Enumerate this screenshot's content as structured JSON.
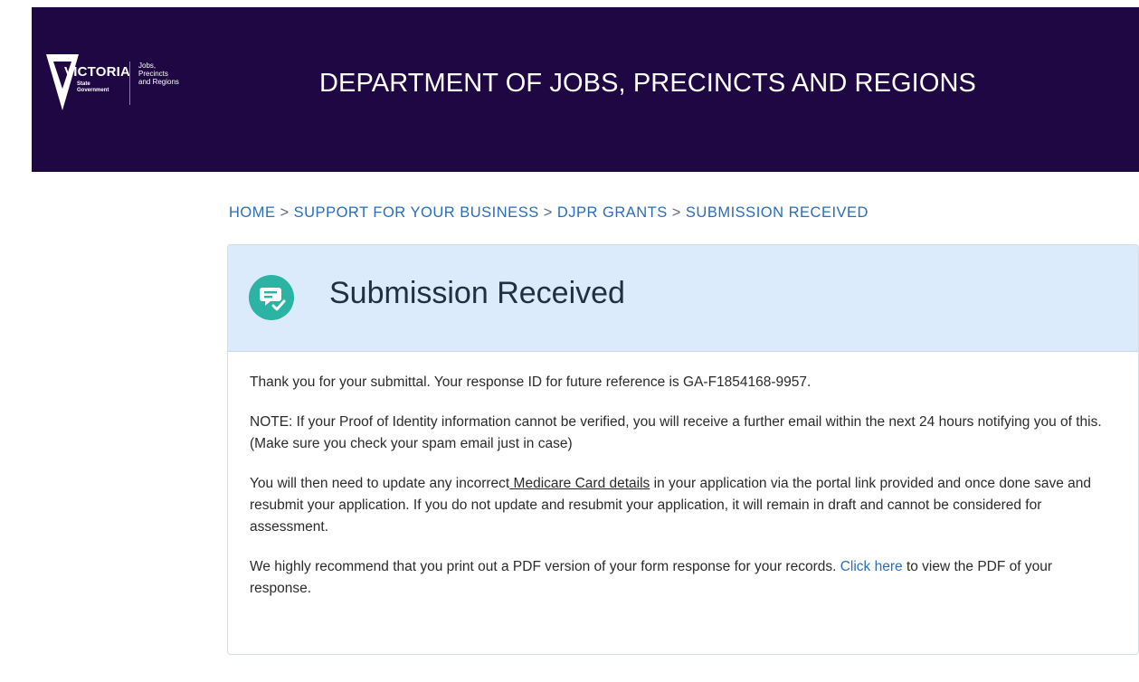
{
  "header": {
    "logo_word": "VICTORIA",
    "logo_sub": "State\nGovernment",
    "logo_dept": "Jobs,\nPrecincts\nand Regions",
    "title": "DEPARTMENT OF JOBS, PRECINCTS AND REGIONS",
    "bg_color": "#1e0742"
  },
  "breadcrumb": {
    "items": [
      "HOME",
      "SUPPORT FOR YOUR BUSINESS",
      "DJPR GRANTS",
      "SUBMISSION RECEIVED"
    ],
    "separator": ">"
  },
  "card": {
    "icon": "submission-check-icon",
    "icon_color": "#2bb3a4",
    "title": "Submission Received",
    "p1": "Thank you for your submittal. Your response ID for future reference is GA-F1854168-9957.",
    "p2": "NOTE: If your Proof of Identity information cannot be verified, you will receive a further email within the next 24 hours notifying you of this. (Make sure you check your spam email just in case)",
    "p3_before": "You will then need to update any incorrect",
    "p3_link": " Medicare Card details",
    "p3_after": " in your application via the portal link provided and once done save and resubmit your application. If you do not update and resubmit your application, it will remain in draft and cannot be considered for assessment.",
    "p4_before": "We highly recommend that you print out a PDF version of your form response for your records. ",
    "p4_link": "Click here",
    "p4_after": " to view the PDF of your response."
  }
}
